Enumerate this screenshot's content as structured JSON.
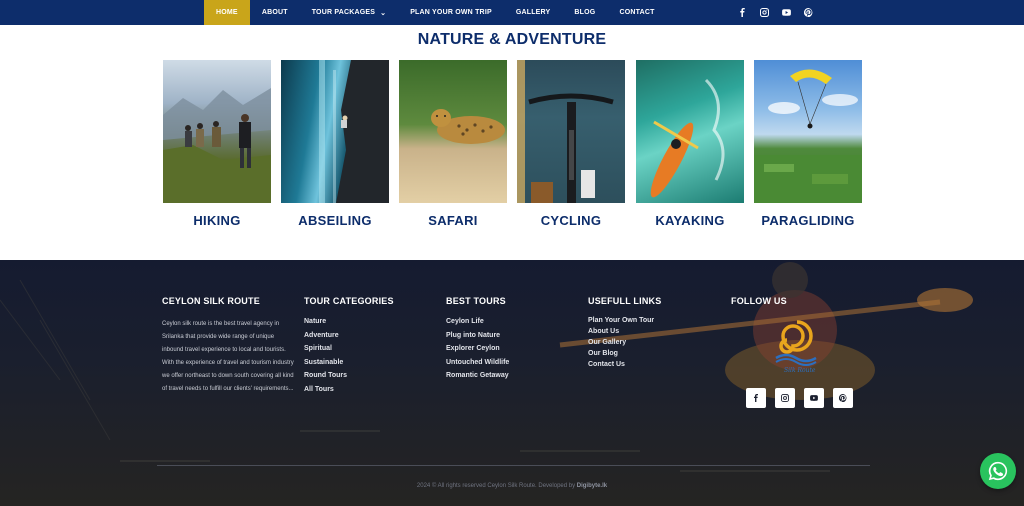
{
  "nav": {
    "items": [
      {
        "label": "HOME",
        "active": true
      },
      {
        "label": "ABOUT"
      },
      {
        "label": "TOUR PACKAGES",
        "dropdown": true
      },
      {
        "label": "PLAN YOUR OWN TRIP"
      },
      {
        "label": "GALLERY"
      },
      {
        "label": "BLOG"
      },
      {
        "label": "CONTACT"
      }
    ],
    "social_icons": [
      "facebook-icon",
      "instagram-icon",
      "youtube-icon",
      "pinterest-icon"
    ]
  },
  "section": {
    "title": "NATURE & ADVENTURE",
    "activities": [
      {
        "label": "HIKING"
      },
      {
        "label": "ABSEILING"
      },
      {
        "label": "SAFARI"
      },
      {
        "label": "CYCLING"
      },
      {
        "label": "KAYAKING"
      },
      {
        "label": "PARAGLIDING"
      }
    ]
  },
  "footer": {
    "about": {
      "heading": "CEYLON SILK ROUTE",
      "description": "Ceylon silk route is the best travel agency in Srilanka that provide wide range of unique inbound travel experience to local and tourists. With the experience of travel and tourism industry we offer northeast to down south covering all kind of travel needs to fulfill our clients' requirements..."
    },
    "categories": {
      "heading": "TOUR CATEGORIES",
      "links": [
        "Nature",
        "Adventure",
        "Spiritual",
        "Sustainable",
        "Round Tours",
        "All Tours"
      ]
    },
    "best_tours": {
      "heading": "BEST TOURS",
      "links": [
        "Ceylon Life",
        "Plug into Nature",
        "Explorer Ceylon",
        "Untouched Wildlife",
        "Romantic Getaway"
      ]
    },
    "useful_links": {
      "heading": "USEFULL LINKS",
      "links": [
        "Plan Your Own Tour",
        "About Us",
        "Our Gallery",
        "Our Blog",
        "Contact Us"
      ]
    },
    "follow": {
      "heading": "FOLLOW US",
      "logo_text": "Silk Route",
      "social_icons": [
        "facebook-icon",
        "instagram-icon",
        "youtube-icon",
        "pinterest-icon"
      ]
    },
    "copyright_prefix": "2024 © All rights reserved Ceylon Silk Route. Developed by",
    "copyright_dev": "Digibyte.lk"
  },
  "colors": {
    "navy": "#0d2d6b",
    "gold": "#c9a51a",
    "whatsapp": "#29c35e"
  }
}
